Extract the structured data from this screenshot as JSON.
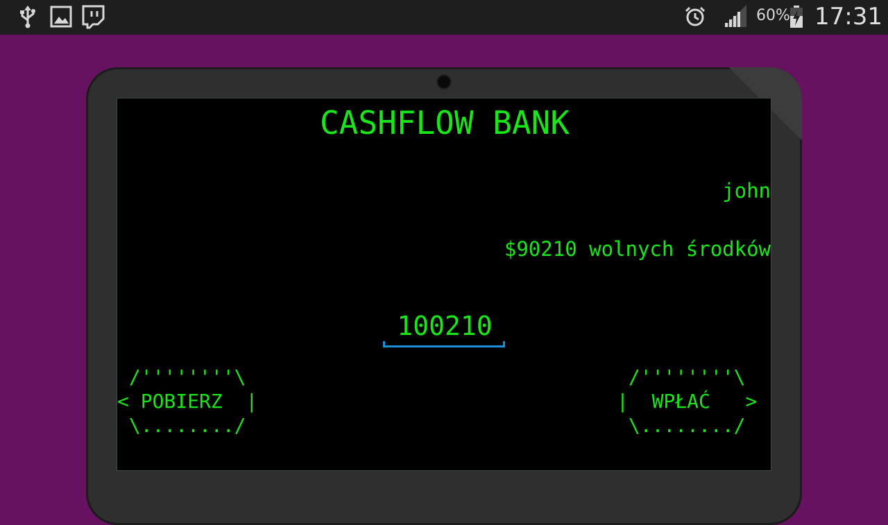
{
  "status_bar": {
    "left_icons": [
      "usb-icon",
      "gallery-icon",
      "twitch-icon"
    ],
    "right_icons": [
      "alarm-icon",
      "signal-icon",
      "battery-charging-icon"
    ],
    "battery_percent": "60%",
    "clock": "17:31"
  },
  "colors": {
    "background": "#661260",
    "status_bar": "#1e1e1e",
    "tablet_bezel": "#2f2f2f",
    "screen": "#000000",
    "terminal_green": "#19e619",
    "input_underline": "#1a8fd6"
  },
  "app": {
    "title": "CASHFLOW BANK",
    "username": "john",
    "funds_text": "$90210 wolnych środków",
    "amount_value": "100210",
    "withdraw_button": {
      "top": " /''''''''\\",
      "middle": "< POBIERZ  |",
      "bottom": " \\......../",
      "label": "POBIERZ"
    },
    "deposit_button": {
      "top": " /''''''''\\",
      "middle": "|  WPŁAĆ   >",
      "bottom": " \\......../",
      "label": "WPŁAĆ"
    }
  }
}
